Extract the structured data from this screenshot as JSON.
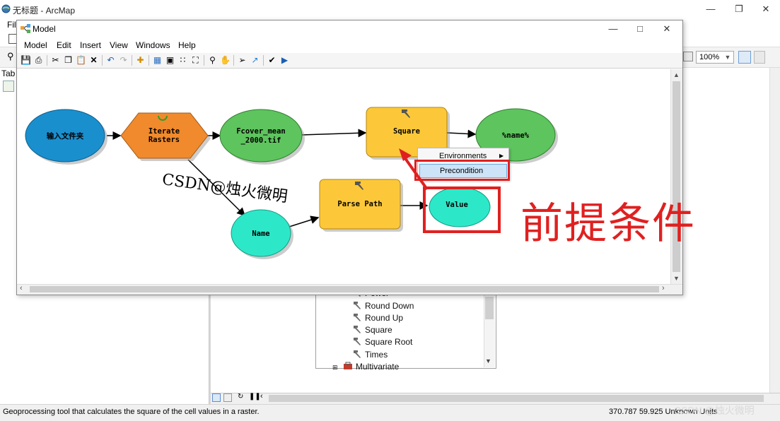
{
  "arcmap": {
    "title": "无标题 - ArcMap",
    "menu_first": "File",
    "zoom_level": "100%",
    "left_panel_tab": "Tab",
    "status_text": "Geoprocessing tool that calculates the square of the cell values in a raster.",
    "coords": "370.787  59.925 Unknown Units"
  },
  "toolbox_tree": {
    "items": [
      {
        "label": "Power",
        "icon": "hammer-icon"
      },
      {
        "label": "Round Down",
        "icon": "hammer-icon"
      },
      {
        "label": "Round Up",
        "icon": "hammer-icon"
      },
      {
        "label": "Square",
        "icon": "hammer-icon"
      },
      {
        "label": "Square Root",
        "icon": "hammer-icon"
      },
      {
        "label": "Times",
        "icon": "hammer-icon"
      },
      {
        "label": "Multivariate",
        "icon": "toolbox-icon"
      }
    ]
  },
  "model_window": {
    "title": "Model",
    "menu": [
      "Model",
      "Edit",
      "Insert",
      "View",
      "Windows",
      "Help"
    ],
    "nodes": {
      "input_folder": "输入文件夹",
      "iterate_line1": "Iterate",
      "iterate_line2": "Rasters",
      "fcover_line1": "Fcover_mean",
      "fcover_line2": "_2000.tif",
      "square": "Square",
      "name_output": "%name%",
      "parse_path": "Parse Path",
      "name": "Name",
      "value": "Value"
    },
    "context_menu": {
      "environments": "Environments",
      "precondition": "Precondition"
    }
  },
  "annotations": {
    "label": "前提条件",
    "watermark_canvas": "CSDN@烛火微明",
    "watermark_bottom": "CSDN @烛火微明"
  },
  "colors": {
    "annotation_red": "#e02020",
    "node_blue": "#1a8fce",
    "node_orange": "#f08a2c",
    "node_green": "#5ec45e",
    "node_yellow": "#fcc83a",
    "node_cyan": "#2de8c8"
  }
}
